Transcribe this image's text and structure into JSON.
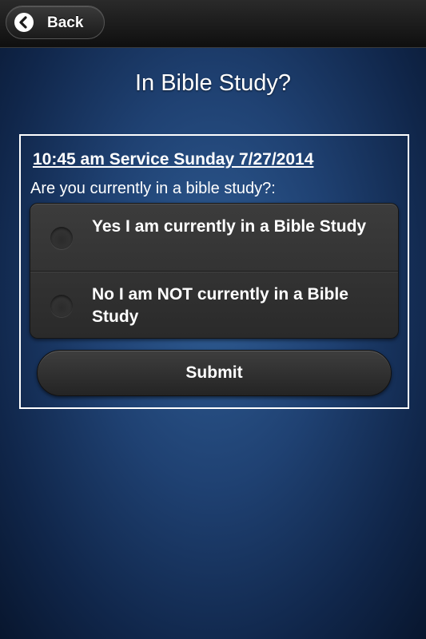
{
  "header": {
    "back_label": "Back",
    "back_icon": "chevron-left-icon"
  },
  "page": {
    "title": "In Bible Study?"
  },
  "form": {
    "service_title": "10:45 am Service Sunday 7/27/2014",
    "question": "Are you currently in a bible study?:",
    "options": [
      {
        "label": "Yes I am currently in a Bible Study",
        "selected": false
      },
      {
        "label": "No I am NOT currently in a Bible Study",
        "selected": false
      }
    ],
    "submit_label": "Submit"
  },
  "colors": {
    "background": "#1f4172",
    "header": "#1a1a1a",
    "text": "#ffffff"
  }
}
